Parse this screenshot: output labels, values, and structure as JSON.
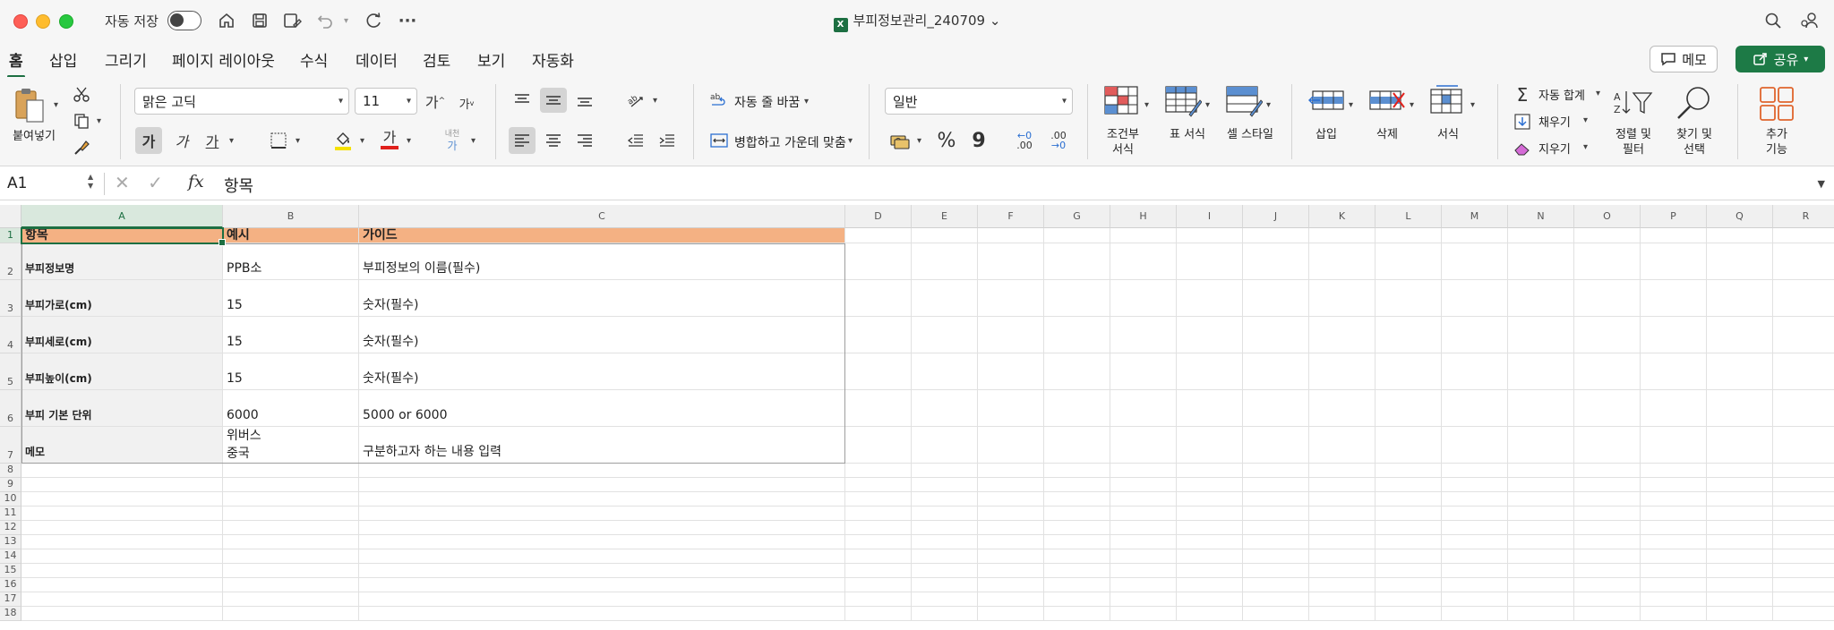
{
  "titlebar": {
    "autosave_label": "자동 저장",
    "file_name": "부피정보관리_240709",
    "file_name_chevron": "⌄"
  },
  "tabs": [
    {
      "label": "홈",
      "active": true
    },
    {
      "label": "삽입"
    },
    {
      "label": "그리기"
    },
    {
      "label": "페이지 레이아웃"
    },
    {
      "label": "수식"
    },
    {
      "label": "데이터"
    },
    {
      "label": "검토"
    },
    {
      "label": "보기"
    },
    {
      "label": "자동화"
    }
  ],
  "header_buttons": {
    "memo": "메모",
    "share": "공유"
  },
  "ribbon": {
    "paste_label": "붙여넣기",
    "font_name": "맑은 고딕",
    "font_size": "11",
    "grow_font": "가",
    "shrink_font": "가",
    "bold": "가",
    "italic": "가",
    "underline": "가",
    "font_color_glyph": "가",
    "phonetic_top": "내천",
    "phonetic_bottom": "가",
    "wrap_text": "자동 줄 바꿈",
    "merge_center": "병합하고 가운데 맞춤",
    "number_format": "일반",
    "percent": "%",
    "comma": "9",
    "inc_decimal": ".00",
    "dec_decimal": ".00",
    "conditional_format": [
      "조건부",
      "서식"
    ],
    "format_as_table": "표 서식",
    "cell_styles": "셀 스타일",
    "insert": "삽입",
    "delete": "삭제",
    "format": "서식",
    "autosum": "자동 합계",
    "fill": "채우기",
    "clear": "지우기",
    "sort_filter": [
      "정렬 및",
      "필터"
    ],
    "find_select": [
      "찾기 및",
      "선택"
    ],
    "addins": [
      "추가",
      "기능"
    ]
  },
  "formula_bar": {
    "name_box": "A1",
    "fx": "fx",
    "content": "항목"
  },
  "columns": [
    "A",
    "B",
    "C",
    "D",
    "E",
    "F",
    "G",
    "H",
    "I",
    "J",
    "K",
    "L",
    "M",
    "N",
    "O",
    "P",
    "Q",
    "R"
  ],
  "rows": [
    "1",
    "2",
    "3",
    "4",
    "5",
    "6",
    "7",
    "8",
    "9",
    "10",
    "11",
    "12",
    "13",
    "14",
    "15",
    "16",
    "17",
    "18"
  ],
  "sheet": {
    "header": {
      "a": "항목",
      "b": "예시",
      "c": "가이드"
    },
    "data_rows": [
      {
        "a": "부피정보명",
        "b": "PPB소",
        "c": "부피정보의 이름(필수)"
      },
      {
        "a": "부피가로(cm)",
        "b": "15",
        "c": "숫자(필수)"
      },
      {
        "a": "부피세로(cm)",
        "b": "15",
        "c": "숫자(필수)"
      },
      {
        "a": "부피높이(cm)",
        "b": "15",
        "c": "숫자(필수)"
      },
      {
        "a": "부피 기본 단위",
        "b": "6000",
        "c": "5000 or 6000"
      },
      {
        "a": "메모",
        "b": "위버스",
        "b2": "중국",
        "c": "구분하고자 하는 내용 입력"
      }
    ]
  },
  "colors": {
    "accent": "#1d6f42",
    "header_fill": "#f4b183",
    "label_fill": "#f1f1f1",
    "font_color_bar": "#e0201b",
    "highlight_bar": "#f5e100"
  }
}
